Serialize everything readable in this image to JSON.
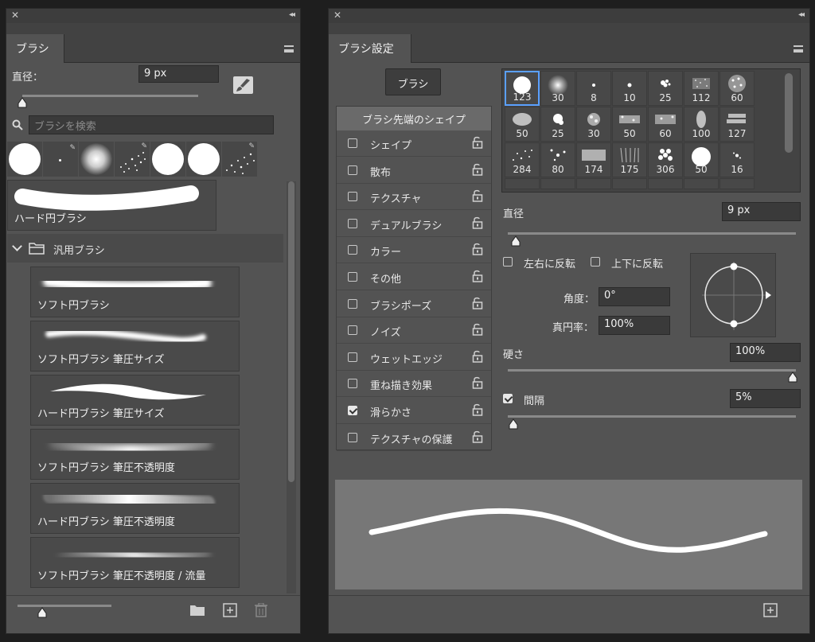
{
  "left": {
    "tab": "ブラシ",
    "diameter_label": "直径：",
    "diameter_value": "9 px",
    "search_placeholder": "ブラシを検索",
    "selected_brush": "ハード円ブラシ",
    "group_name": "汎用ブラシ",
    "brushes": [
      "ソフト円ブラシ",
      "ソフト円ブラシ 筆圧サイズ",
      "ハード円ブラシ 筆圧サイズ",
      "ソフト円ブラシ 筆圧不透明度",
      "ハード円ブラシ 筆圧不透明度",
      "ソフト円ブラシ 筆圧不透明度 / 流量"
    ]
  },
  "right": {
    "tab": "ブラシ設定",
    "brush_button": "ブラシ",
    "tip_shape_header": "ブラシ先端のシェイプ",
    "settings": [
      {
        "label": "シェイプ",
        "checked": false
      },
      {
        "label": "散布",
        "checked": false
      },
      {
        "label": "テクスチャ",
        "checked": false
      },
      {
        "label": "デュアルブラシ",
        "checked": false
      },
      {
        "label": "カラー",
        "checked": false
      },
      {
        "label": "その他",
        "checked": false
      },
      {
        "label": "ブラシポーズ",
        "checked": false
      },
      {
        "label": "ノイズ",
        "checked": false
      },
      {
        "label": "ウェットエッジ",
        "checked": false
      },
      {
        "label": "重ね描き効果",
        "checked": false
      },
      {
        "label": "滑らかさ",
        "checked": true
      },
      {
        "label": "テクスチャの保護",
        "checked": false
      }
    ],
    "tip_sizes": [
      "123",
      "30",
      "8",
      "10",
      "25",
      "112",
      "60",
      "50",
      "25",
      "30",
      "50",
      "60",
      "100",
      "127",
      "284",
      "80",
      "174",
      "175",
      "306",
      "50",
      "16"
    ],
    "diameter_label": "直径",
    "diameter_value": "9 px",
    "diameter_level": 0.02,
    "flip_x_label": "左右に反転",
    "flip_y_label": "上下に反転",
    "angle_label": "角度：",
    "angle_value": "0°",
    "roundness_label": "真円率：",
    "roundness_value": "100%",
    "hardness_label": "硬さ",
    "hardness_value": "100%",
    "hardness_level": 1.0,
    "spacing_label": "間隔",
    "spacing_value": "5%",
    "spacing_checked": true,
    "spacing_level": 0.01
  }
}
